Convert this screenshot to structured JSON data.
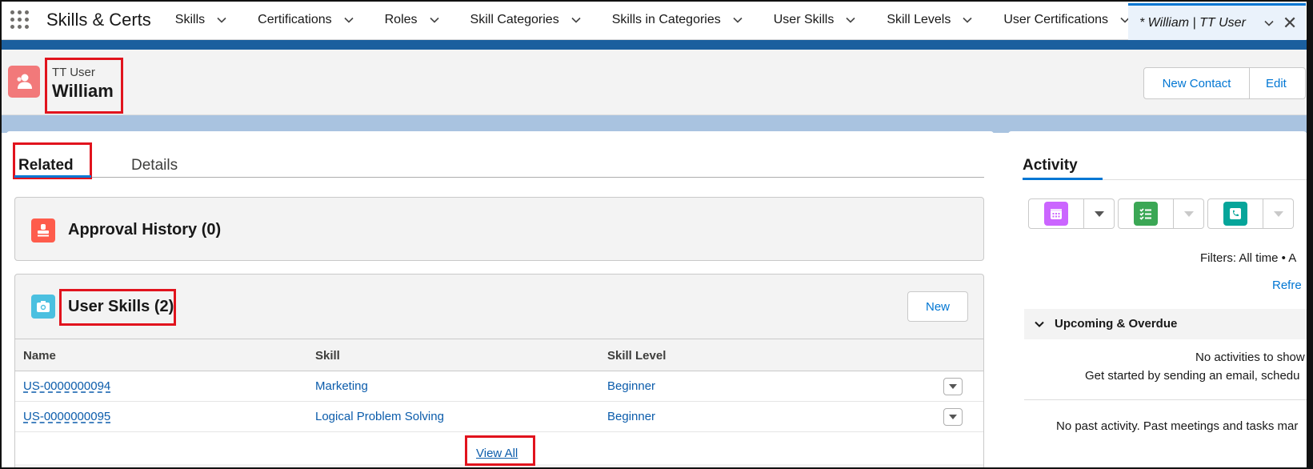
{
  "nav": {
    "app_name": "Skills & Certs",
    "items": [
      {
        "label": "Skills"
      },
      {
        "label": "Certifications"
      },
      {
        "label": "Roles"
      },
      {
        "label": "Skill Categories"
      },
      {
        "label": "Skills in Categories"
      },
      {
        "label": "User Skills"
      },
      {
        "label": "Skill Levels"
      },
      {
        "label": "User Certifications"
      }
    ],
    "active_tab": "* William | TT User"
  },
  "header": {
    "record_type": "TT User",
    "record_name": "William",
    "buttons": {
      "new_contact": "New Contact",
      "edit": "Edit"
    }
  },
  "tabs": {
    "related": "Related",
    "details": "Details"
  },
  "approval_history": {
    "title": "Approval History (0)"
  },
  "user_skills": {
    "title": "User Skills (2)",
    "new_button": "New",
    "columns": [
      "Name",
      "Skill",
      "Skill Level"
    ],
    "rows": [
      {
        "name": "US-0000000094",
        "skill": "Marketing",
        "level": "Beginner"
      },
      {
        "name": "US-0000000095",
        "skill": "Logical Problem Solving",
        "level": "Beginner"
      }
    ],
    "view_all": "View All"
  },
  "activity": {
    "tab": "Activity",
    "filters": "Filters: All time • A",
    "refresh": "Refre",
    "upcoming": "Upcoming & Overdue",
    "no_activities": "No activities to show",
    "get_started": "Get started by sending an email, schedu",
    "no_past": "No past activity. Past meetings and tasks mar",
    "colors": {
      "event": "#cb65ff",
      "task": "#3ba755",
      "call": "#06a59a"
    }
  }
}
